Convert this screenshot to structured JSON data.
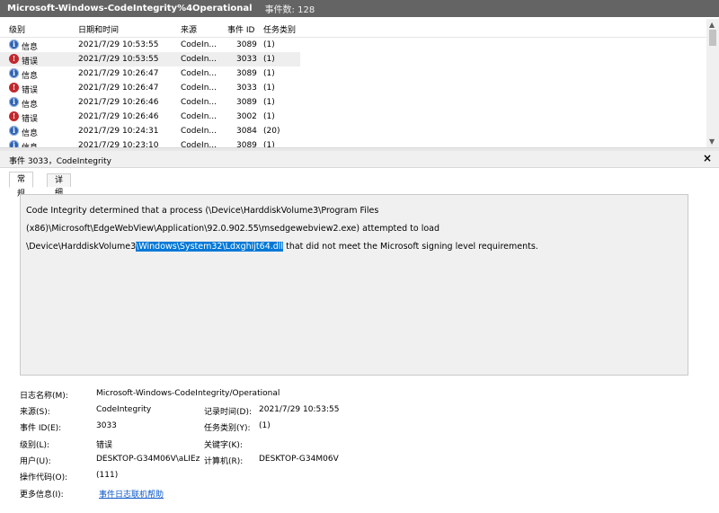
{
  "titlebar": {
    "log_name": "Microsoft-Windows-CodeIntegrity%4Operational",
    "event_count": "事件数: 128"
  },
  "grid": {
    "headers": {
      "level": "级别",
      "date": "日期和时间",
      "source": "来源",
      "event_id": "事件 ID",
      "task": "任务类别"
    },
    "rows": [
      {
        "level": "信息",
        "icon": "info-icon",
        "date": "2021/7/29 10:53:55",
        "source": "CodeIn...",
        "event_id": "3089",
        "task": "(1)"
      },
      {
        "level": "错误",
        "icon": "error-icon",
        "date": "2021/7/29 10:53:55",
        "source": "CodeIn...",
        "event_id": "3033",
        "task": "(1)"
      },
      {
        "level": "信息",
        "icon": "info-icon",
        "date": "2021/7/29 10:26:47",
        "source": "CodeIn...",
        "event_id": "3089",
        "task": "(1)"
      },
      {
        "level": "错误",
        "icon": "error-icon",
        "date": "2021/7/29 10:26:47",
        "source": "CodeIn...",
        "event_id": "3033",
        "task": "(1)"
      },
      {
        "level": "信息",
        "icon": "info-icon",
        "date": "2021/7/29 10:26:46",
        "source": "CodeIn...",
        "event_id": "3089",
        "task": "(1)"
      },
      {
        "level": "错误",
        "icon": "error-icon",
        "date": "2021/7/29 10:26:46",
        "source": "CodeIn...",
        "event_id": "3002",
        "task": "(1)"
      },
      {
        "level": "信息",
        "icon": "info-icon",
        "date": "2021/7/29 10:24:31",
        "source": "CodeIn...",
        "event_id": "3084",
        "task": "(20)"
      },
      {
        "level": "信息",
        "icon": "info-icon",
        "date": "2021/7/29 10:23:10",
        "source": "CodeIn...",
        "event_id": "3089",
        "task": "(1)"
      }
    ]
  },
  "detail": {
    "header": "事件 3033，CodeIntegrity",
    "close": "×",
    "tabs": {
      "general": "常规",
      "details": "详细信息"
    },
    "message": {
      "part1": "Code Integrity determined that a process (\\Device\\HarddiskVolume3\\Program Files (x86)\\Microsoft\\EdgeWebView\\Application\\92.0.902.55\\msedgewebview2.exe) attempted to load \\Device\\HarddiskVolume3",
      "highlight": "\\Windows\\System32\\Ldxghijt64.dll",
      "part2": " that did not meet the Microsoft signing level requirements."
    },
    "props": {
      "log_name_label": "日志名称(M):",
      "log_name_value": "Microsoft-Windows-CodeIntegrity/Operational",
      "source_label": "来源(S):",
      "source_value": "CodeIntegrity",
      "logged_label": "记录时间(D):",
      "logged_value": "2021/7/29 10:53:55",
      "event_id_label": "事件 ID(E):",
      "event_id_value": "3033",
      "task_label": "任务类别(Y):",
      "task_value": "(1)",
      "level_label": "级别(L):",
      "level_value": "错误",
      "keywords_label": "关键字(K):",
      "keywords_value": "",
      "user_label": "用户(U):",
      "user_value": "DESKTOP-G34M06V\\aLIEz",
      "computer_label": "计算机(R):",
      "computer_value": "DESKTOP-G34M06V",
      "opcode_label": "操作代码(O):",
      "opcode_value": "(111)",
      "more_info_label": "更多信息(I):",
      "more_info_link": "事件日志联机帮助"
    }
  },
  "colors": {
    "titlebar": "#646464",
    "selection_highlight": "#0078d7",
    "error": "#c0282d",
    "info": "#2e62b4",
    "link": "#0b57c9"
  }
}
